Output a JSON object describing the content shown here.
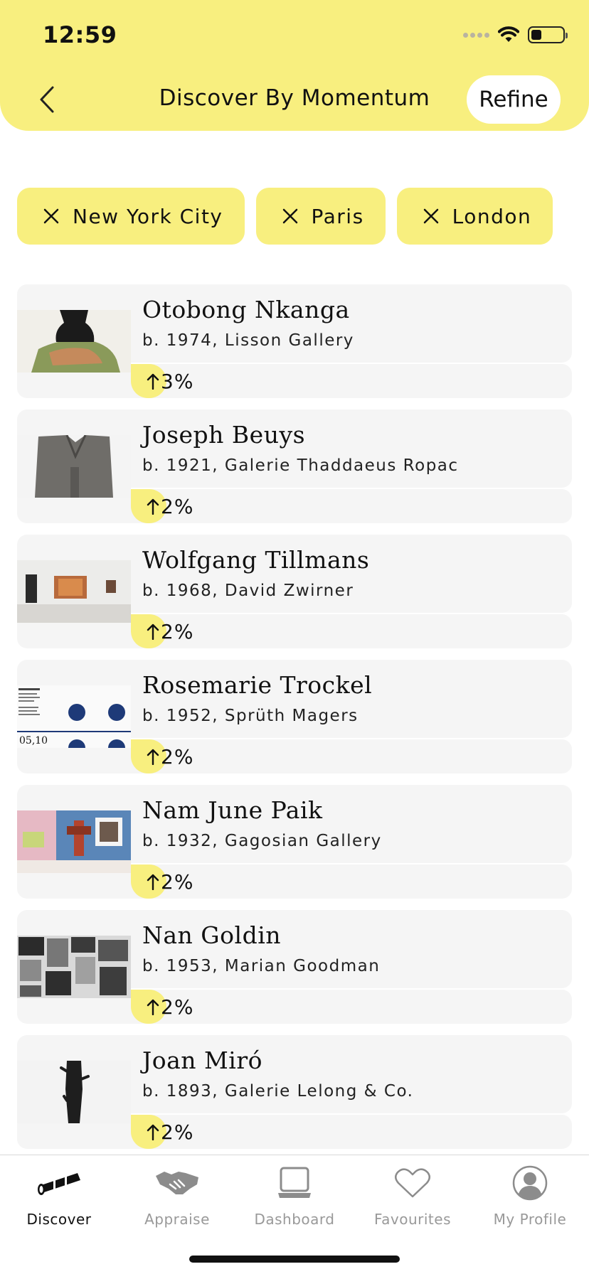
{
  "status_bar": {
    "time": "12:59"
  },
  "header": {
    "title": "Discover By Momentum",
    "refine_label": "Refine"
  },
  "filters": [
    {
      "label": "New York City"
    },
    {
      "label": "Paris"
    },
    {
      "label": "London"
    }
  ],
  "artists": [
    {
      "name": "Otobong Nkanga",
      "meta": "b. 1974, Lisson Gallery",
      "change": "3%",
      "direction": "up"
    },
    {
      "name": "Joseph Beuys",
      "meta": "b. 1921, Galerie Thaddaeus Ropac",
      "change": "2%",
      "direction": "up"
    },
    {
      "name": "Wolfgang Tillmans",
      "meta": "b. 1968, David Zwirner",
      "change": "2%",
      "direction": "up"
    },
    {
      "name": "Rosemarie Trockel",
      "meta": "b. 1952, Sprüth Magers",
      "change": "2%",
      "direction": "up"
    },
    {
      "name": "Nam June Paik",
      "meta": "b. 1932, Gagosian Gallery",
      "change": "2%",
      "direction": "up"
    },
    {
      "name": "Nan Goldin",
      "meta": "b. 1953, Marian Goodman",
      "change": "2%",
      "direction": "up"
    },
    {
      "name": "Joan Miró",
      "meta": "b. 1893, Galerie Lelong & Co.",
      "change": "2%",
      "direction": "up"
    }
  ],
  "thumb_text": {
    "trockel": "05,10"
  },
  "tabbar": {
    "items": [
      {
        "label": "Discover",
        "icon": "telescope-icon",
        "active": true
      },
      {
        "label": "Appraise",
        "icon": "handshake-icon",
        "active": false
      },
      {
        "label": "Dashboard",
        "icon": "laptop-icon",
        "active": false
      },
      {
        "label": "Favourites",
        "icon": "heart-icon",
        "active": false
      },
      {
        "label": "My Profile",
        "icon": "profile-icon",
        "active": false
      }
    ]
  },
  "colors": {
    "accent": "#f8ef7f",
    "card": "#f5f5f5",
    "inactive": "#999999"
  }
}
